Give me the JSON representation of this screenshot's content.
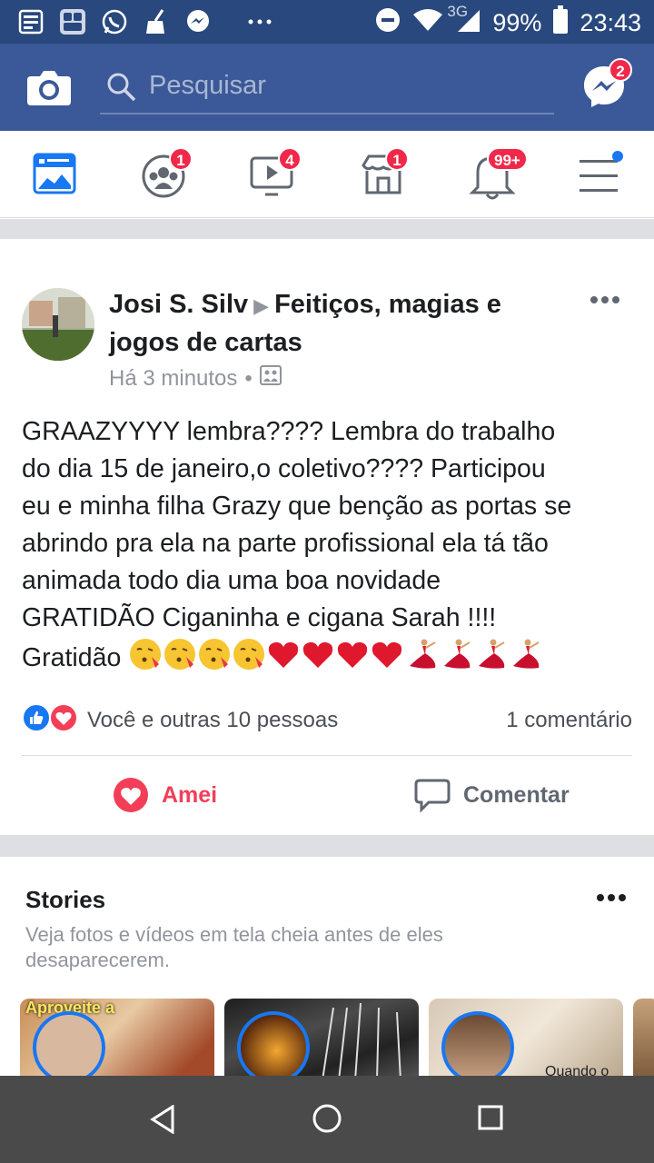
{
  "statusbar": {
    "network": "3G",
    "battery": "99%",
    "time": "23:43",
    "notification_icons": [
      "news-icon",
      "gallery-icon",
      "whatsapp-icon",
      "cleaner-icon",
      "messenger-icon",
      "more-dots-icon"
    ]
  },
  "header": {
    "search_placeholder": "Pesquisar",
    "messenger_badge": "2"
  },
  "tabs": [
    {
      "name": "news-feed",
      "badge": ""
    },
    {
      "name": "groups",
      "badge": "1"
    },
    {
      "name": "watch",
      "badge": "4"
    },
    {
      "name": "marketplace",
      "badge": "1"
    },
    {
      "name": "notifications",
      "badge": "99+"
    },
    {
      "name": "menu",
      "badge": ""
    }
  ],
  "post": {
    "author": "Josi S. Silv",
    "group": "Feitiços, magias e jogos de cartas",
    "time": "Há 3 minutos",
    "text_lines": [
      "GRAAZYYYY lembra???? Lembra do trabalho",
      "do dia 15 de janeiro,o coletivo???? Participou",
      "eu e minha filha Grazy que benção as portas se",
      "abrindo pra ela na parte profissional ela tá tão",
      "animada todo dia uma boa novidade",
      "GRATIDÃO Ciganinha e cigana Sarah !!!!",
      "Gratidão"
    ],
    "reactions_text": "Você e outras 10 pessoas",
    "comments_text": "1 comentário",
    "love_label": "Amei",
    "comment_label": "Comentar"
  },
  "stories": {
    "title": "Stories",
    "subtitle": "Veja fotos e vídeos em tela cheia antes de eles desaparecerem.",
    "card1_text": "Aproveite a",
    "card3_text": "Quando o"
  },
  "colors": {
    "fb_blue": "#3b5998",
    "status_blue": "#29487d",
    "love_red": "#f33e58",
    "badge_red": "#f02849"
  }
}
